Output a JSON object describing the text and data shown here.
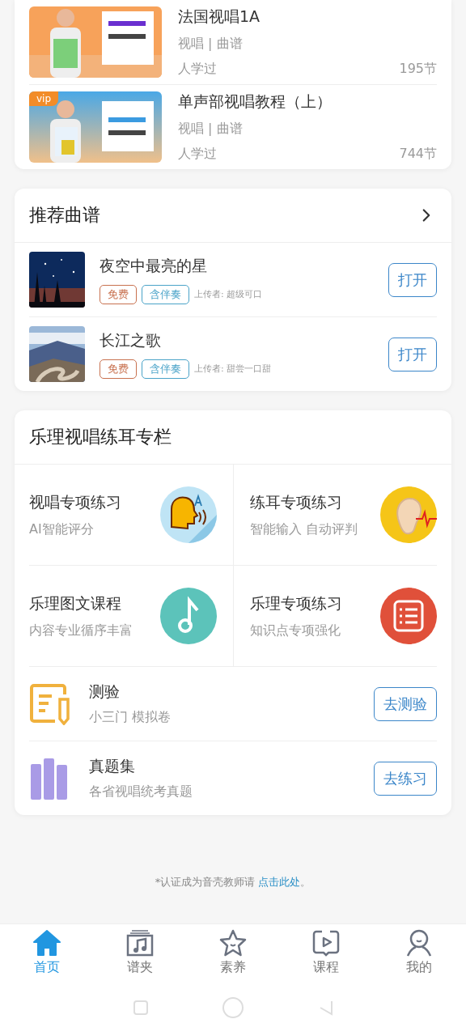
{
  "courses": [
    {
      "title": "法国视唱1A",
      "meta": "视唱 | 曲谱",
      "learners": "人学过",
      "lessons": "195节"
    },
    {
      "title": "单声部视唱教程（上）",
      "meta": "视唱 | 曲谱",
      "learners": "人学过",
      "lessons": "744节",
      "badge": "vip"
    }
  ],
  "scores": {
    "title": "推荐曲谱",
    "items": [
      {
        "title": "夜空中最亮的星",
        "tags": [
          {
            "label": "免费",
            "kind": "free"
          },
          {
            "label": "含伴奏",
            "kind": "accompaniment"
          }
        ],
        "uploader": "上传者: 超级可口",
        "button": "打开"
      },
      {
        "title": "长江之歌",
        "tags": [
          {
            "label": "免费",
            "kind": "free"
          },
          {
            "label": "含伴奏",
            "kind": "accompaniment"
          }
        ],
        "uploader": "上传者: 甜尝一口甜",
        "button": "打开"
      }
    ]
  },
  "theory": {
    "title": "乐理视唱练耳专栏",
    "tiles": [
      {
        "title": "视唱专项练习",
        "subtitle": "AI智能评分",
        "kind": "voice"
      },
      {
        "title": "练耳专项练习",
        "subtitle": "智能输入 自动评判",
        "kind": "ear"
      },
      {
        "title": "乐理图文课程",
        "subtitle": "内容专业循序丰富",
        "kind": "note"
      },
      {
        "title": "乐理专项练习",
        "subtitle": "知识点专项强化",
        "kind": "list"
      }
    ],
    "rows": [
      {
        "title": "测验",
        "subtitle": "小三门 模拟卷",
        "button": "去测验",
        "kind": "quiz"
      },
      {
        "title": "真题集",
        "subtitle": "各省视唱统考真题",
        "button": "去练习",
        "kind": "bars"
      }
    ]
  },
  "note": {
    "text": "*认证成为音壳教师请 ",
    "link": "点击此处",
    "end": "。"
  },
  "tabs": [
    {
      "label": "首页",
      "selected": true
    },
    {
      "label": "谱夹",
      "selected": false
    },
    {
      "label": "素养",
      "selected": false
    },
    {
      "label": "课程",
      "selected": false
    },
    {
      "label": "我的",
      "selected": false
    }
  ]
}
